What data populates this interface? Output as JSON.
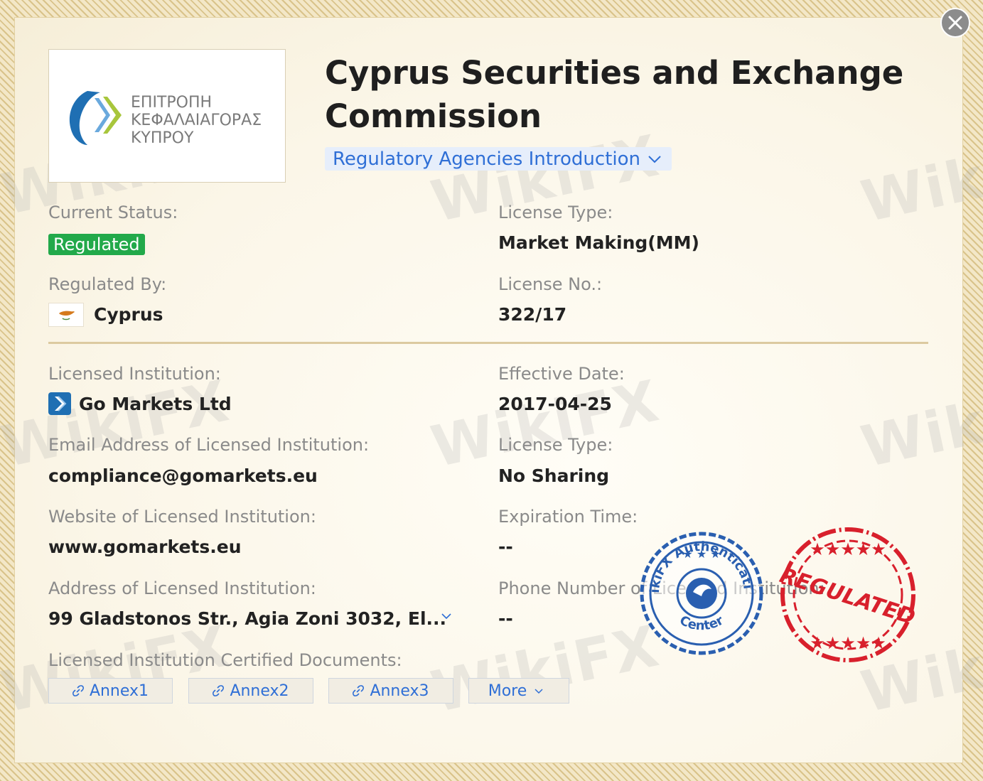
{
  "header": {
    "title": "Cyprus Securities and Exchange Commission",
    "intro_label": "Regulatory Agencies Introduction"
  },
  "logo": {
    "lines": [
      "ΕΠΙΤΡΟΠΗ",
      "ΚΕΦΑΛΑΙΑΓΟΡΑΣ",
      "ΚΥΠΡΟΥ"
    ]
  },
  "watermark_text": "WikiFX",
  "status": {
    "label": "Current Status:",
    "value": "Regulated"
  },
  "license_type_1": {
    "label": "License Type:",
    "value": "Market Making(MM)"
  },
  "regulated_by": {
    "label": "Regulated By:",
    "value": "Cyprus"
  },
  "license_no": {
    "label": "License No.:",
    "value": "322/17"
  },
  "institution": {
    "label": "Licensed Institution:",
    "value": "Go Markets Ltd"
  },
  "effective_date": {
    "label": "Effective Date:",
    "value": "2017-04-25"
  },
  "email": {
    "label": "Email Address of Licensed Institution:",
    "value": "compliance@gomarkets.eu"
  },
  "license_type_2": {
    "label": "License Type:",
    "value": "No Sharing"
  },
  "website": {
    "label": "Website of Licensed Institution:",
    "value": "www.gomarkets.eu"
  },
  "expiration": {
    "label": "Expiration Time:",
    "value": "--"
  },
  "address": {
    "label": "Address of Licensed Institution:",
    "value": "99 Gladstonos Str., Agia Zoni 3032, El..."
  },
  "phone": {
    "label": "Phone Number of Licensed Institution:",
    "value": "--"
  },
  "documents": {
    "label": "Licensed Institution Certified Documents:",
    "buttons": [
      "Annex1",
      "Annex2",
      "Annex3"
    ],
    "more_label": "More"
  },
  "stamps": {
    "auth_top": "WikiFX Authentication",
    "auth_side": "Center",
    "regulated": "REGULATED"
  },
  "colors": {
    "accent": "#2f6fd6",
    "regulated_green": "#22a94a",
    "stamp_blue": "#2a5fb0",
    "stamp_red": "#d8202c",
    "divider": "#dccaa0"
  }
}
